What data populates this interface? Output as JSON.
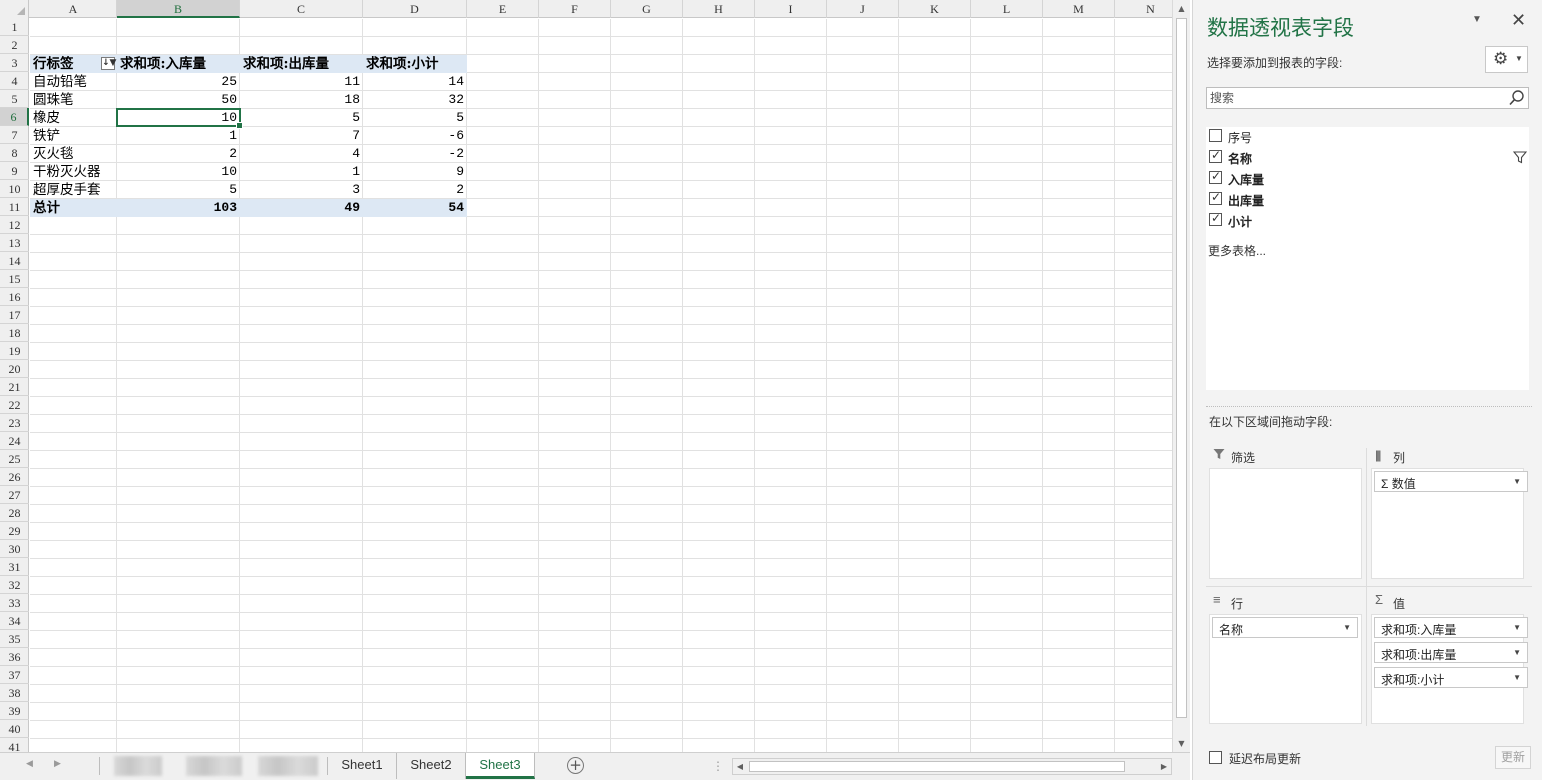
{
  "spreadsheet": {
    "columns": [
      "A",
      "B",
      "C",
      "D",
      "E",
      "F",
      "G",
      "H",
      "I",
      "J",
      "K",
      "L",
      "M",
      "N"
    ],
    "active_column": "B",
    "active_row": "6",
    "rows": [
      "1",
      "2",
      "3",
      "4",
      "5",
      "6",
      "7",
      "8",
      "9",
      "10",
      "11",
      "12",
      "13",
      "14",
      "15",
      "16",
      "17",
      "18",
      "19",
      "20",
      "21",
      "22",
      "23",
      "24",
      "25",
      "26",
      "27",
      "28",
      "29",
      "30",
      "31",
      "32",
      "33",
      "34",
      "35",
      "36",
      "37",
      "38",
      "39",
      "40",
      "41"
    ],
    "pivot": {
      "headers": [
        "行标签",
        "求和项:入库量",
        "求和项:出库量",
        "求和项:小计"
      ],
      "rows": [
        {
          "label": "自动铅笔",
          "in": "25",
          "out": "11",
          "sub": "14"
        },
        {
          "label": "圆珠笔",
          "in": "50",
          "out": "18",
          "sub": "32"
        },
        {
          "label": "橡皮",
          "in": "10",
          "out": "5",
          "sub": "5"
        },
        {
          "label": "铁铲",
          "in": "1",
          "out": "7",
          "sub": "-6"
        },
        {
          "label": "灭火毯",
          "in": "2",
          "out": "4",
          "sub": "-2"
        },
        {
          "label": "干粉灭火器",
          "in": "10",
          "out": "1",
          "sub": "9"
        },
        {
          "label": "超厚皮手套",
          "in": "5",
          "out": "3",
          "sub": "2"
        }
      ],
      "total": {
        "label": "总计",
        "in": "103",
        "out": "49",
        "sub": "54"
      }
    }
  },
  "tabs": {
    "sheets": [
      "Sheet1",
      "Sheet2",
      "Sheet3"
    ],
    "active": "Sheet3",
    "add_icon": "plus-circle-icon"
  },
  "pane": {
    "title": "数据透视表字段",
    "subtitle": "选择要添加到报表的字段:",
    "search_placeholder": "搜索",
    "fields": [
      {
        "label": "序号",
        "checked": false
      },
      {
        "label": "名称",
        "checked": true
      },
      {
        "label": "入库量",
        "checked": true
      },
      {
        "label": "出库量",
        "checked": true
      },
      {
        "label": "小计",
        "checked": true
      }
    ],
    "more_tables": "更多表格...",
    "drag_hint": "在以下区域间拖动字段:",
    "areas": {
      "filter": {
        "label": "筛选",
        "items": []
      },
      "columns": {
        "label": "列",
        "items": [
          "Σ 数值"
        ]
      },
      "rows": {
        "label": "行",
        "items": [
          "名称"
        ]
      },
      "values": {
        "label": "值",
        "items": [
          "求和项:入库量",
          "求和项:出库量",
          "求和项:小计"
        ]
      }
    },
    "defer_label": "延迟布局更新",
    "update_label": "更新"
  },
  "colors": {
    "accent": "#217346",
    "pivot_header_bg": "#dde8f4",
    "pane_bg": "#f3f3f3"
  }
}
